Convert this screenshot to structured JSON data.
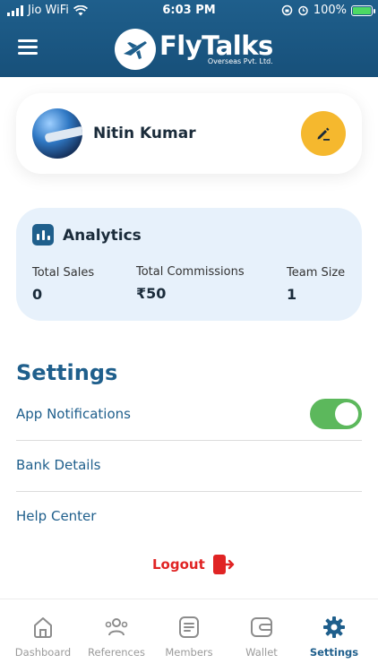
{
  "status_bar": {
    "carrier": "Jio WiFi",
    "time": "6:03 PM",
    "battery": "100%"
  },
  "header": {
    "brand": "FlyTalks",
    "subtitle": "Overseas Pvt. Ltd."
  },
  "profile": {
    "name": "Nitin Kumar"
  },
  "analytics": {
    "title": "Analytics",
    "stats": [
      {
        "label": "Total Sales",
        "value": "0"
      },
      {
        "label": "Total Commissions",
        "value": "₹50"
      },
      {
        "label": "Team Size",
        "value": "1"
      }
    ]
  },
  "settings": {
    "title": "Settings",
    "items": [
      {
        "label": "App Notifications",
        "toggle_on": true
      },
      {
        "label": "Bank Details"
      },
      {
        "label": "Help Center"
      }
    ],
    "logout_label": "Logout"
  },
  "bottom_nav": {
    "items": [
      {
        "label": "Dashboard",
        "icon": "home-icon"
      },
      {
        "label": "References",
        "icon": "people-icon"
      },
      {
        "label": "Members",
        "icon": "list-icon"
      },
      {
        "label": "Wallet",
        "icon": "wallet-icon"
      },
      {
        "label": "Settings",
        "icon": "gear-icon",
        "active": true
      }
    ]
  },
  "colors": {
    "primary": "#1f5f8c",
    "edit_button": "#f5b82e",
    "toggle_on": "#5cb85c",
    "logout": "#e02424",
    "analytics_bg": "#e7f1fb"
  }
}
